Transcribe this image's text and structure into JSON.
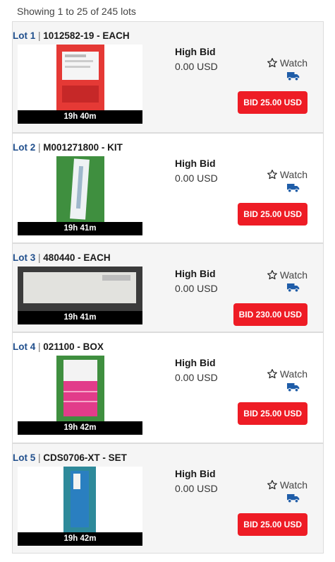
{
  "showing": "Showing 1 to 25 of 245 lots",
  "lots": [
    {
      "lot_label": "Lot 1",
      "separator": "|",
      "desc": "1012582-19 - EACH",
      "timer": "19h 40m",
      "high_bid_label": "High Bid",
      "high_bid_value": "0.00 USD",
      "watch_label": "Watch",
      "bid_label": "BID 25.00 USD"
    },
    {
      "lot_label": "Lot 2",
      "separator": "|",
      "desc": "M001271800 - KIT",
      "timer": "19h 41m",
      "high_bid_label": "High Bid",
      "high_bid_value": "0.00 USD",
      "watch_label": "Watch",
      "bid_label": "BID 25.00 USD"
    },
    {
      "lot_label": "Lot 3",
      "separator": "|",
      "desc": "480440 - EACH",
      "timer": "19h 41m",
      "high_bid_label": "High Bid",
      "high_bid_value": "0.00 USD",
      "watch_label": "Watch",
      "bid_label": "BID 230.00 USD"
    },
    {
      "lot_label": "Lot 4",
      "separator": "|",
      "desc": "021100 - BOX",
      "timer": "19h 42m",
      "high_bid_label": "High Bid",
      "high_bid_value": "0.00 USD",
      "watch_label": "Watch",
      "bid_label": "BID 25.00 USD"
    },
    {
      "lot_label": "Lot 5",
      "separator": "|",
      "desc": "CDS0706-XT - SET",
      "timer": "19h 42m",
      "high_bid_label": "High Bid",
      "high_bid_value": "0.00 USD",
      "watch_label": "Watch",
      "bid_label": "BID 25.00 USD"
    }
  ],
  "icons": {
    "watch": "star-outline-icon",
    "shipping": "truck-icon"
  },
  "colors": {
    "bid_button": "#ee1c25",
    "lot_link": "#1f4e8c",
    "truck": "#1f5da8",
    "timer_bg": "#000000"
  }
}
